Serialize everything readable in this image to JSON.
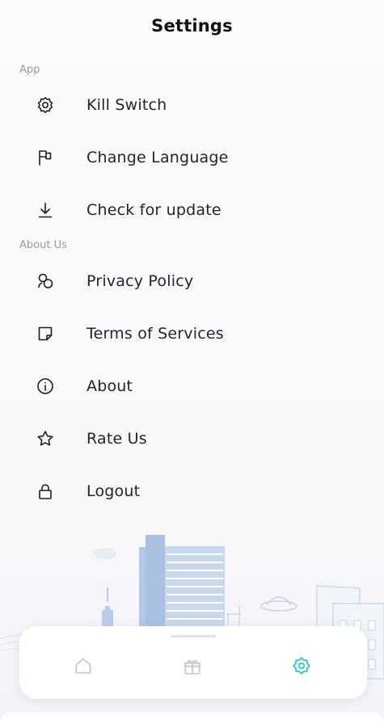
{
  "header": {
    "title": "Settings"
  },
  "sections": {
    "app": {
      "label": "App",
      "items": [
        {
          "label": "Kill Switch",
          "icon": "gear-icon"
        },
        {
          "label": "Change Language",
          "icon": "flag-icon"
        },
        {
          "label": "Check for update",
          "icon": "download-icon"
        }
      ]
    },
    "about": {
      "label": "About Us",
      "items": [
        {
          "label": "Privacy Policy",
          "icon": "privacy-icon"
        },
        {
          "label": "Terms of Services",
          "icon": "note-icon"
        },
        {
          "label": "About",
          "icon": "info-icon"
        },
        {
          "label": "Rate Us",
          "icon": "star-icon"
        },
        {
          "label": "Logout",
          "icon": "lock-icon"
        }
      ]
    }
  },
  "bottom_nav": {
    "items": [
      {
        "name": "home",
        "icon": "home-icon",
        "active": false
      },
      {
        "name": "gift",
        "icon": "gift-icon",
        "active": false
      },
      {
        "name": "settings",
        "icon": "settings-icon",
        "active": true
      }
    ],
    "active_color": "#2cc7d1",
    "inactive_color": "#c8c9cf"
  },
  "colors": {
    "text": "#23232b",
    "section_label": "#9a9aa3",
    "illustration": "#b8cde6"
  }
}
